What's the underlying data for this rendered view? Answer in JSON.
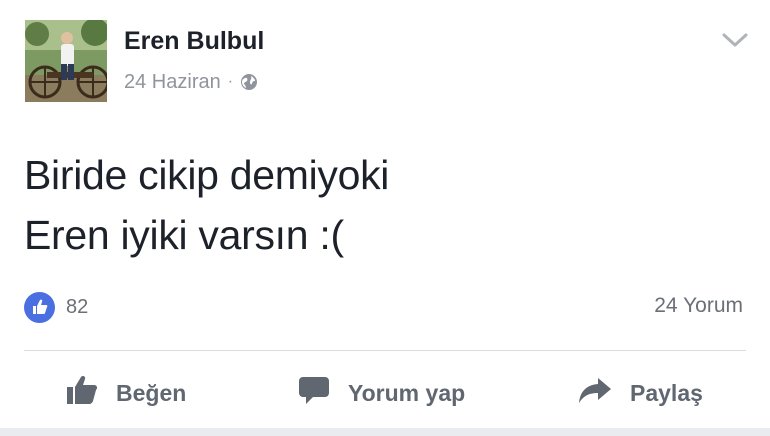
{
  "post": {
    "author": "Eren Bulbul",
    "date": "24 Haziran",
    "separator": "·",
    "privacy_icon": "globe-icon",
    "menu_icon": "chevron-down-icon",
    "text_lines": [
      "Biride cikip demiyoki",
      "Eren iyiki varsın :("
    ],
    "like_count": "82",
    "comment_count": "24 Yorum"
  },
  "actions": {
    "like_label": "Beğen",
    "comment_label": "Yorum yap",
    "share_label": "Paylaş"
  },
  "colors": {
    "like_badge": "#4a6fe0",
    "text": "#1d2129",
    "muted": "#90949c",
    "action": "#606770"
  }
}
